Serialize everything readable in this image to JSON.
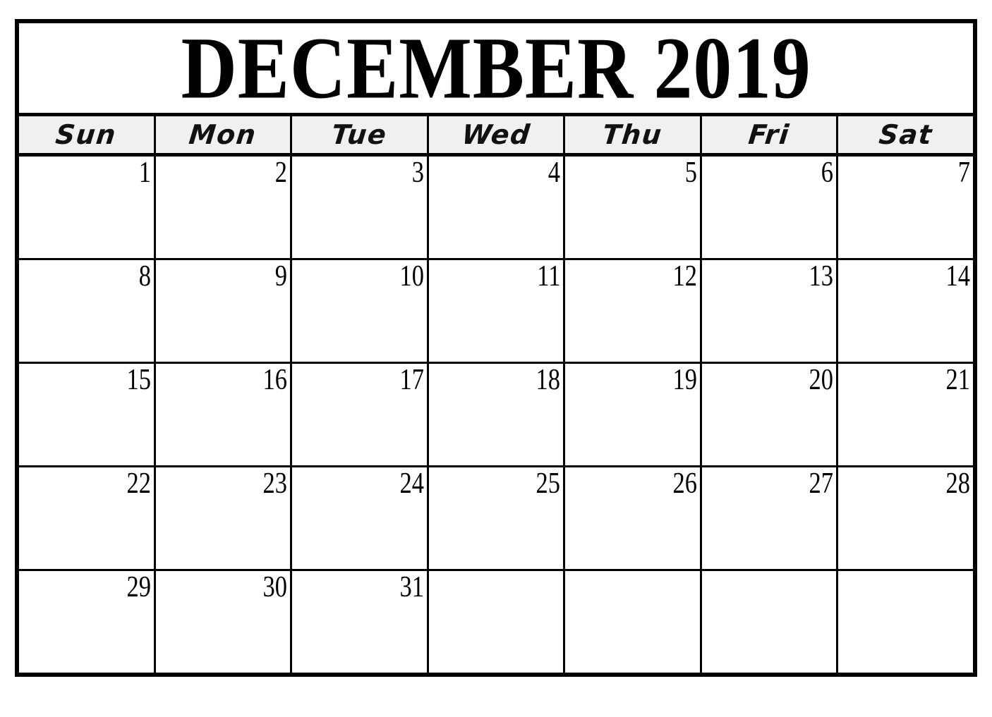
{
  "document": {
    "type": "printable-monthly-calendar",
    "title": "DECEMBER 2019",
    "month": "DECEMBER",
    "year": "2019"
  },
  "colors": {
    "border": "#000000",
    "weekday_band_background": "#f0f0f0",
    "page_background": "#ffffff",
    "text": "#000000"
  },
  "weekdays": [
    {
      "label": "Sun"
    },
    {
      "label": "Mon"
    },
    {
      "label": "Tue"
    },
    {
      "label": "Wed"
    },
    {
      "label": "Thu"
    },
    {
      "label": "Fri"
    },
    {
      "label": "Sat"
    }
  ],
  "weeks": [
    {
      "days": [
        {
          "date": "1"
        },
        {
          "date": "2"
        },
        {
          "date": "3"
        },
        {
          "date": "4"
        },
        {
          "date": "5"
        },
        {
          "date": "6"
        },
        {
          "date": "7"
        }
      ]
    },
    {
      "days": [
        {
          "date": "8"
        },
        {
          "date": "9"
        },
        {
          "date": "10"
        },
        {
          "date": "11"
        },
        {
          "date": "12"
        },
        {
          "date": "13"
        },
        {
          "date": "14"
        }
      ]
    },
    {
      "days": [
        {
          "date": "15"
        },
        {
          "date": "16"
        },
        {
          "date": "17"
        },
        {
          "date": "18"
        },
        {
          "date": "19"
        },
        {
          "date": "20"
        },
        {
          "date": "21"
        }
      ]
    },
    {
      "days": [
        {
          "date": "22"
        },
        {
          "date": "23"
        },
        {
          "date": "24"
        },
        {
          "date": "25"
        },
        {
          "date": "26"
        },
        {
          "date": "27"
        },
        {
          "date": "28"
        }
      ]
    },
    {
      "days": [
        {
          "date": "29"
        },
        {
          "date": "30"
        },
        {
          "date": "31"
        },
        {
          "date": ""
        },
        {
          "date": ""
        },
        {
          "date": ""
        },
        {
          "date": ""
        }
      ]
    }
  ]
}
